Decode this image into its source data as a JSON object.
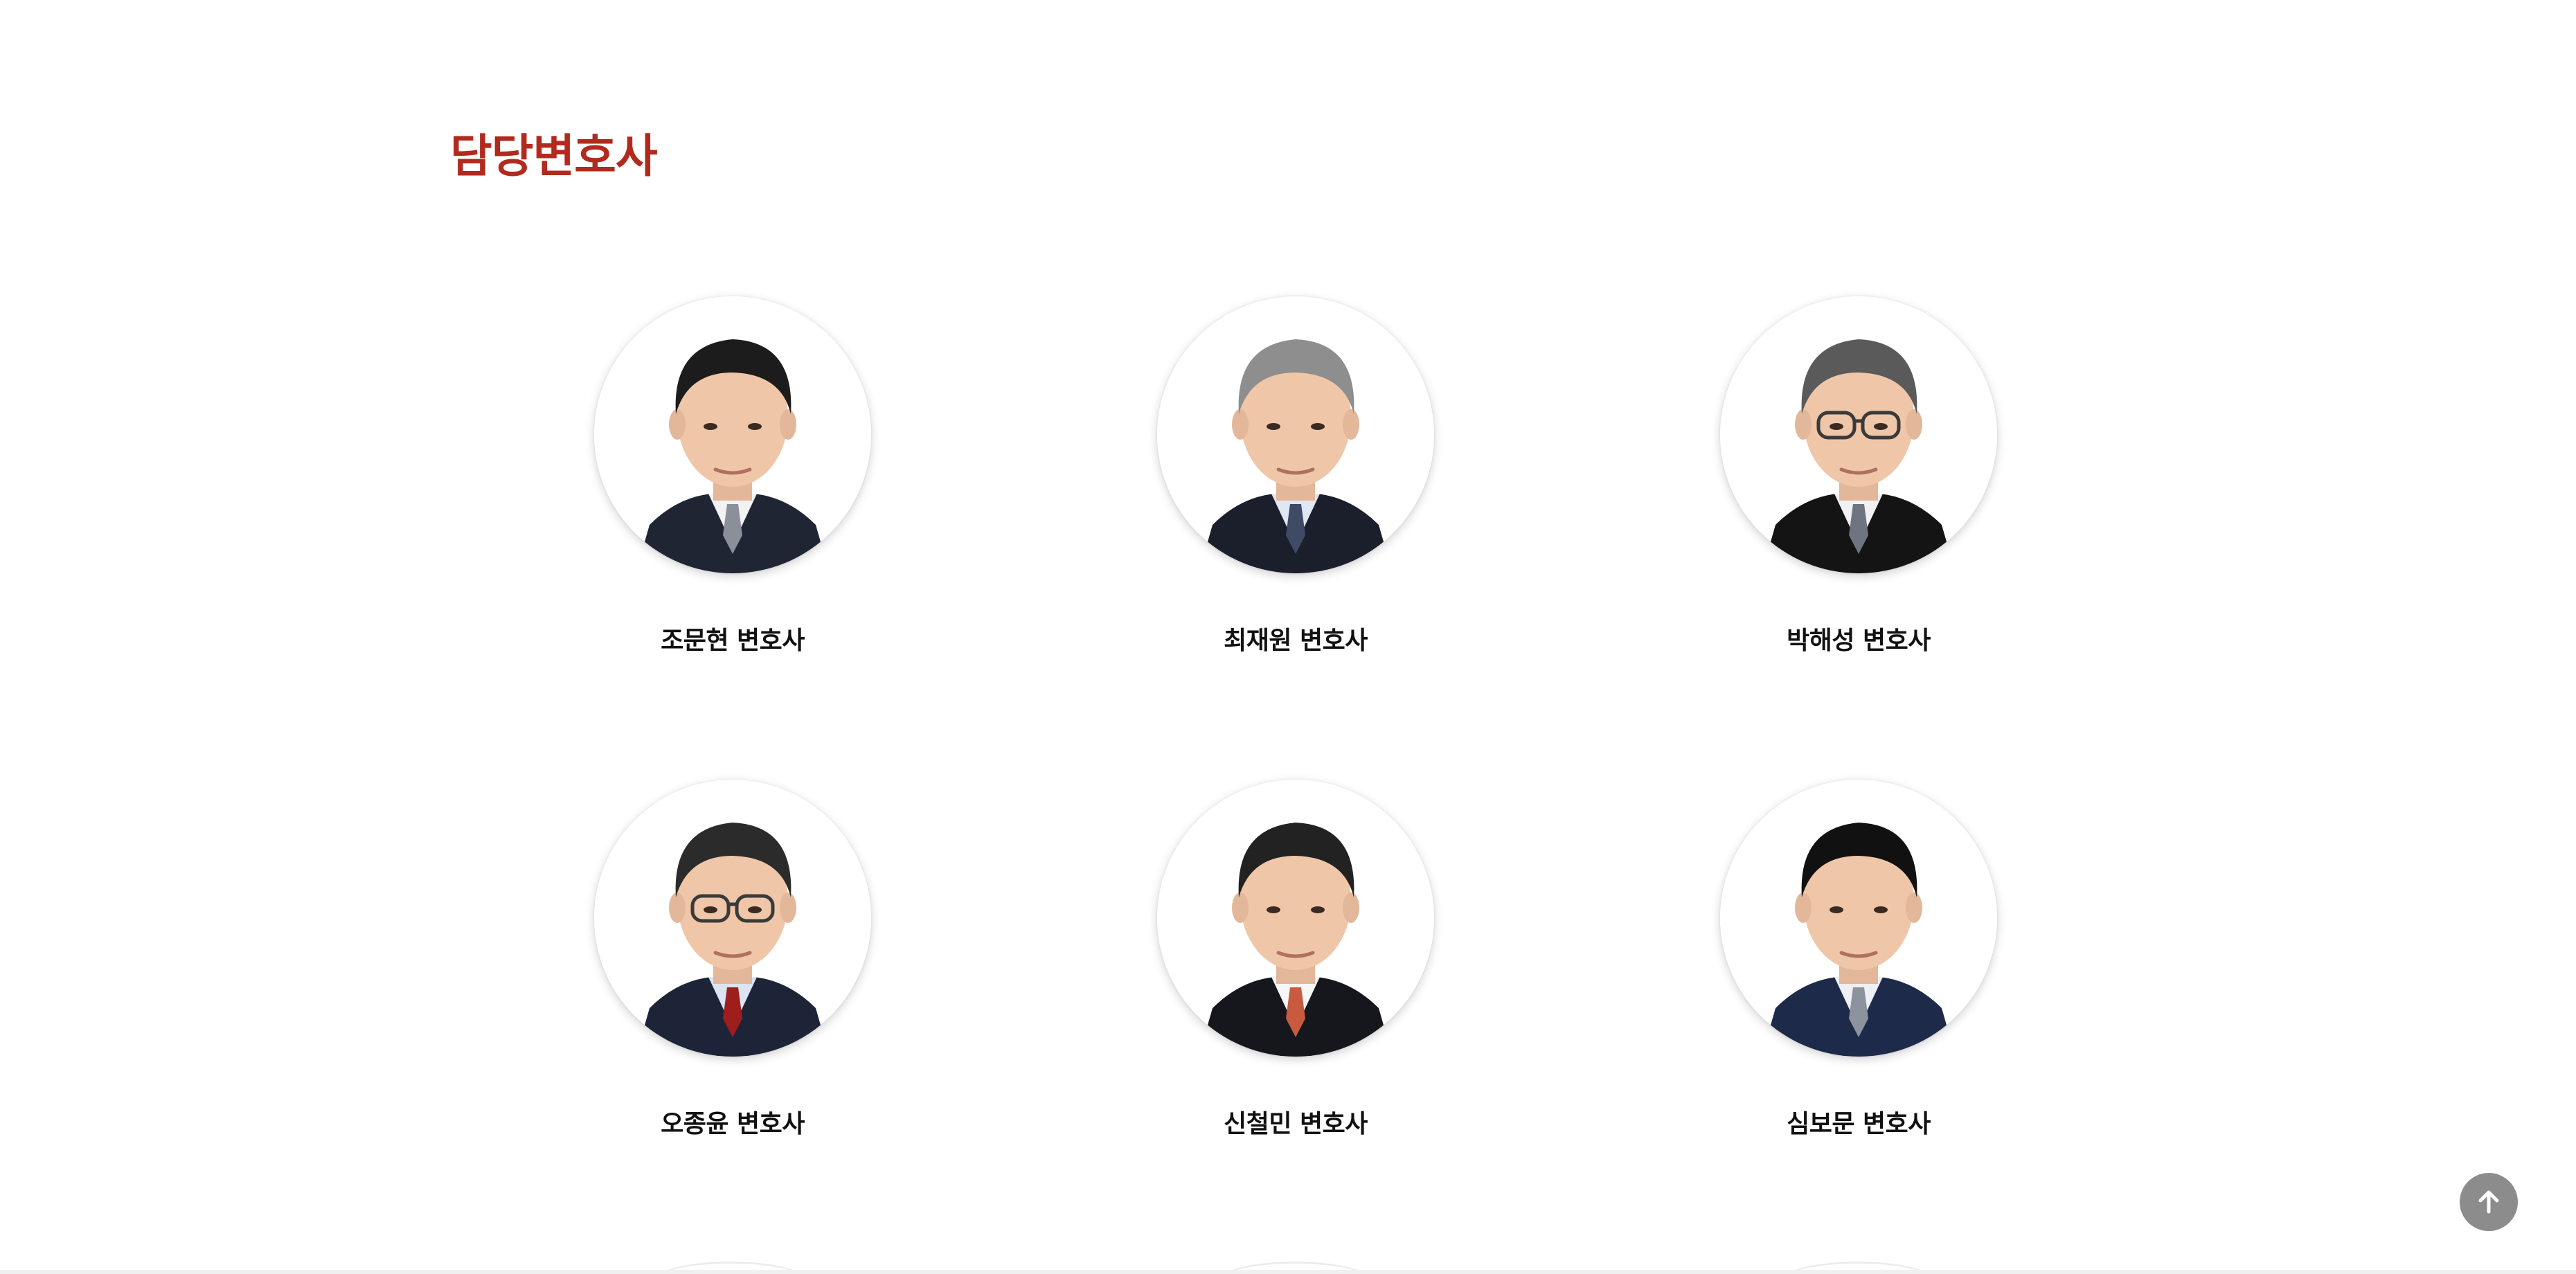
{
  "section": {
    "title": "담당변호사",
    "title_color": "#b22a1e"
  },
  "lawyers": [
    {
      "name": "조문현 변호사",
      "hair": "#1c1c1c",
      "tie": "#8a8f99",
      "shirt": "#f2f2f2",
      "suit": "#1f2533",
      "glasses": false
    },
    {
      "name": "최재원 변호사",
      "hair": "#8e8e8e",
      "tie": "#3e4a66",
      "shirt": "#dfe7f2",
      "suit": "#1b1f2b",
      "glasses": false
    },
    {
      "name": "박해성 변호사",
      "hair": "#5a5a5a",
      "tie": "#6f7480",
      "shirt": "#f2f2f2",
      "suit": "#141414",
      "glasses": true
    },
    {
      "name": "오종윤 변호사",
      "hair": "#2b2b2b",
      "tie": "#9e1e1e",
      "shirt": "#dbe4f1",
      "suit": "#1e2438",
      "glasses": true
    },
    {
      "name": "신철민 변호사",
      "hair": "#222222",
      "tie": "#c75a3f",
      "shirt": "#f6f6f6",
      "suit": "#15171c",
      "glasses": false
    },
    {
      "name": "심보문 변호사",
      "hair": "#111111",
      "tie": "#8d939c",
      "shirt": "#eef0f4",
      "suit": "#1d2a4a",
      "glasses": false
    }
  ],
  "controls": {
    "scroll_top_icon": "arrow-up-icon"
  }
}
